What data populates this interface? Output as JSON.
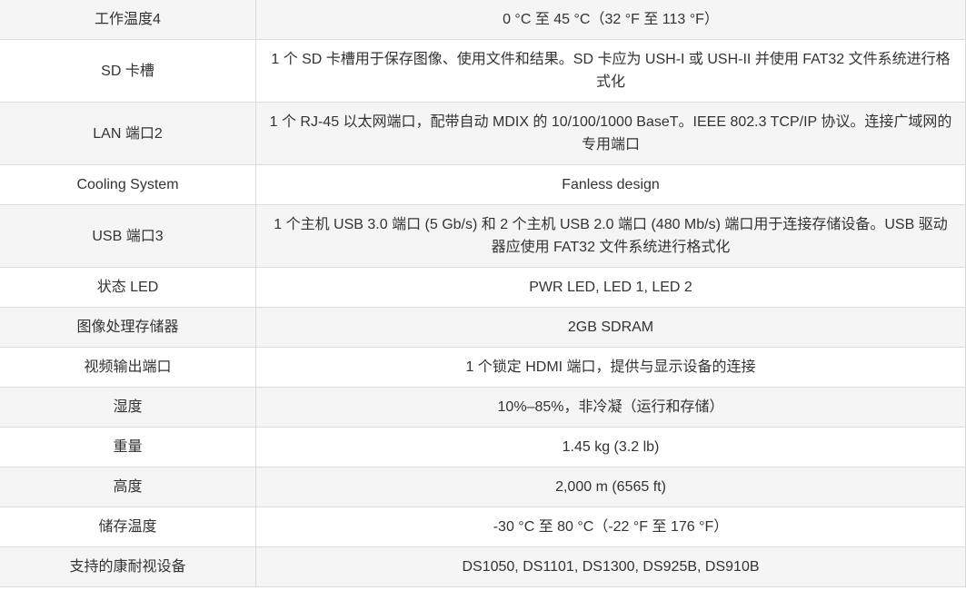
{
  "specs": [
    {
      "label": "工作温度4",
      "value": "0 °C 至 45 °C（32 °F 至 113 °F）"
    },
    {
      "label": "SD 卡槽",
      "value": "1 个 SD 卡槽用于保存图像、使用文件和结果。SD 卡应为 USH-I 或 USH-II 并使用 FAT32 文件系统进行格式化"
    },
    {
      "label": "LAN 端口2",
      "value": "1 个 RJ-45 以太网端口，配带自动 MDIX 的 10/100/1000 BaseT。IEEE 802.3 TCP/IP 协议。连接广域网的专用端口"
    },
    {
      "label": "Cooling System",
      "value": "Fanless design"
    },
    {
      "label": "USB 端口3",
      "value": "1 个主机 USB 3.0 端口 (5 Gb/s) 和 2 个主机 USB 2.0 端口 (480 Mb/s) 端口用于连接存储设备。USB 驱动器应使用 FAT32 文件系统进行格式化"
    },
    {
      "label": "状态 LED",
      "value": "PWR LED, LED 1, LED 2"
    },
    {
      "label": "图像处理存储器",
      "value": "2GB SDRAM"
    },
    {
      "label": "视频输出端口",
      "value": "1 个锁定 HDMI 端口，提供与显示设备的连接"
    },
    {
      "label": "湿度",
      "value": "10%–85%，非冷凝（运行和存储）"
    },
    {
      "label": "重量",
      "value": "1.45 kg (3.2 lb)"
    },
    {
      "label": "高度",
      "value": "2,000 m (6565 ft)"
    },
    {
      "label": "储存温度",
      "value": "-30 °C 至 80 °C（-22 °F 至 176 °F）"
    },
    {
      "label": "支持的康耐视设备",
      "value": "DS1050, DS1101, DS1300, DS925B, DS910B"
    }
  ]
}
